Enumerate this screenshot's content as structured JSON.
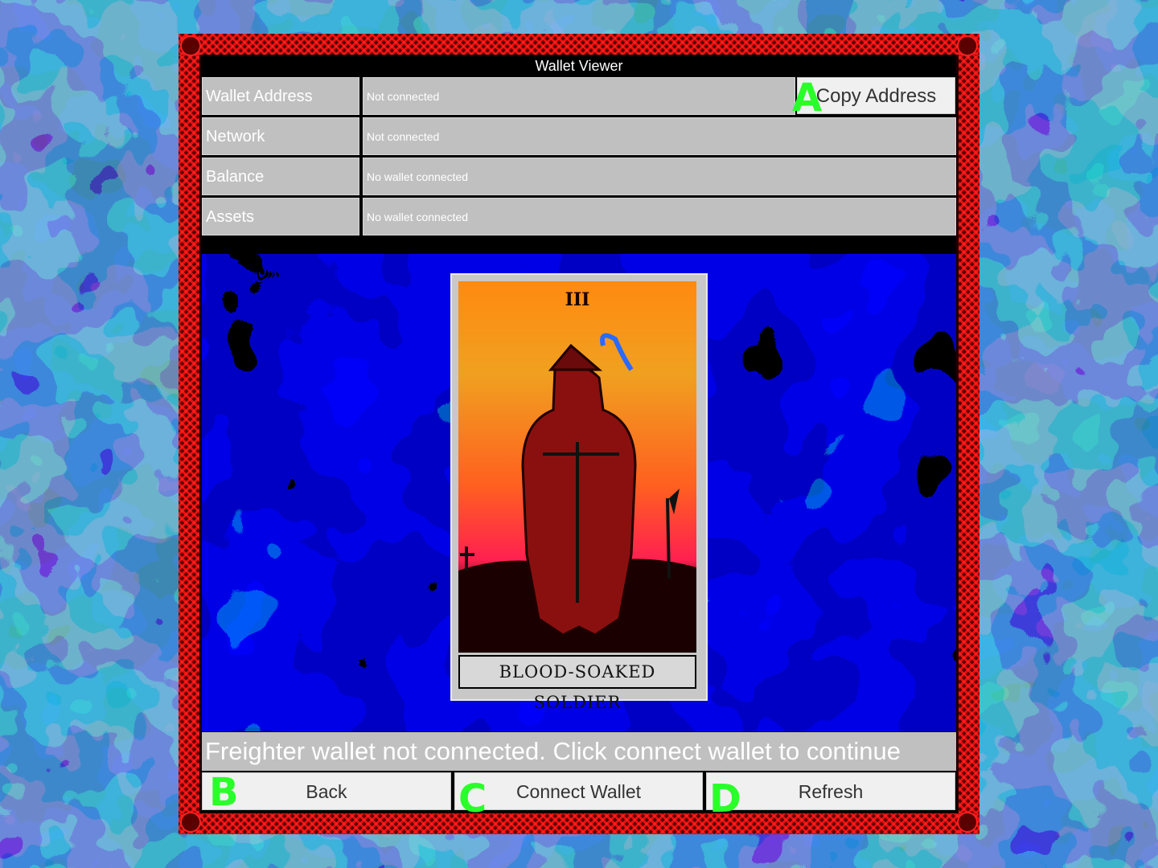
{
  "window": {
    "title": "Wallet Viewer"
  },
  "rows": [
    {
      "label": "Wallet Address",
      "value": "Not connected"
    },
    {
      "label": "Network",
      "value": "Not connected"
    },
    {
      "label": "Balance",
      "value": "No wallet connected"
    },
    {
      "label": "Assets",
      "value": "No wallet connected"
    }
  ],
  "copy_button": {
    "label": "Copy Address"
  },
  "card": {
    "numeral": "III",
    "caption": "BLOOD-SOAKED SOLDIER"
  },
  "status": {
    "message": "Freighter wallet not connected. Click connect wallet to continue"
  },
  "buttons": {
    "back": "Back",
    "connect": "Connect Wallet",
    "refresh": "Refresh"
  },
  "markers": {
    "a": "A",
    "b": "B",
    "c": "C",
    "d": "D"
  },
  "colors": {
    "frame_red": "#e01010",
    "panel_gray": "#c0c0c0",
    "button_bg": "#f0f0f0",
    "scene_blue": "#0000c8",
    "marker_green": "#2aff2a"
  }
}
